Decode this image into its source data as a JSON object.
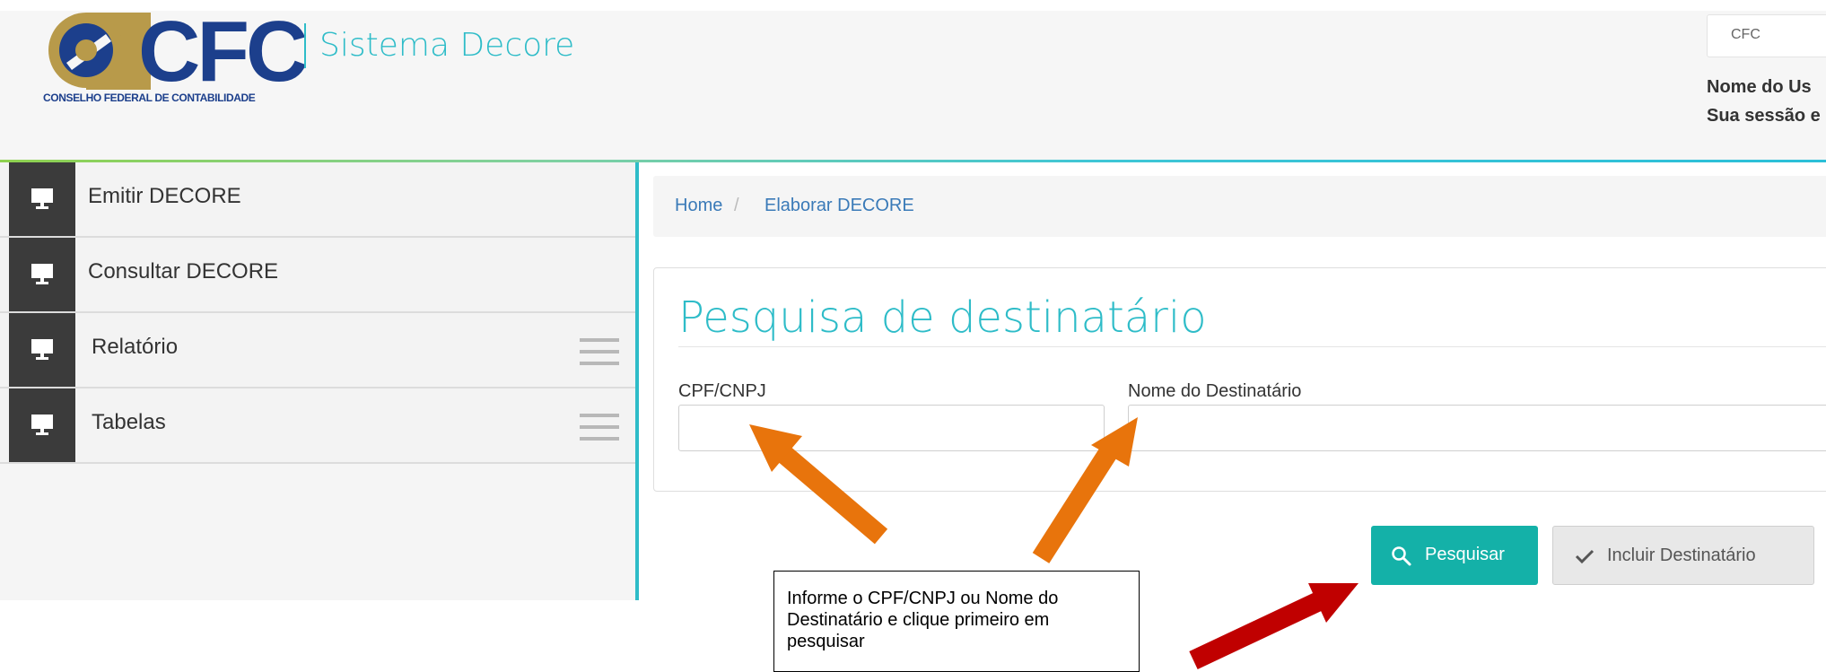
{
  "header": {
    "logo_text": "CFC",
    "logo_subtitle": "CONSELHO FEDERAL DE CONTABILIDADE",
    "system_name": "Sistema Decore",
    "org_select_value": "CFC",
    "user_name": "Nome do Us",
    "session_info": "Sua sessão e"
  },
  "sidebar": {
    "items": [
      {
        "label": "Emitir DECORE",
        "icon": "monitor-icon",
        "has_submenu": false
      },
      {
        "label": "Consultar DECORE",
        "icon": "monitor-icon",
        "has_submenu": false
      },
      {
        "label": "Relatório",
        "icon": "monitor-icon",
        "has_submenu": true
      },
      {
        "label": "Tabelas",
        "icon": "monitor-icon",
        "has_submenu": true
      }
    ]
  },
  "breadcrumb": {
    "home": "Home",
    "separator": "/",
    "current": "Elaborar DECORE"
  },
  "search_panel": {
    "title": "Pesquisa de destinatário",
    "cpf_label": "CPF/CNPJ",
    "cpf_value": "",
    "name_label": "Nome do Destinatário",
    "name_value": ""
  },
  "actions": {
    "search_label": "Pesquisar",
    "add_label": "Incluir Destinatário"
  },
  "annotation": {
    "callout_text": "Informe o CPF/CNPJ ou Nome do Destinatário e clique primeiro em pesquisar"
  },
  "colors": {
    "accent": "#2ebcc8",
    "brand_blue": "#1c3f8c",
    "brand_gold": "#b89a4a",
    "search_button": "#14b1a8",
    "arrow_orange": "#e8740c",
    "arrow_red": "#c00000"
  }
}
